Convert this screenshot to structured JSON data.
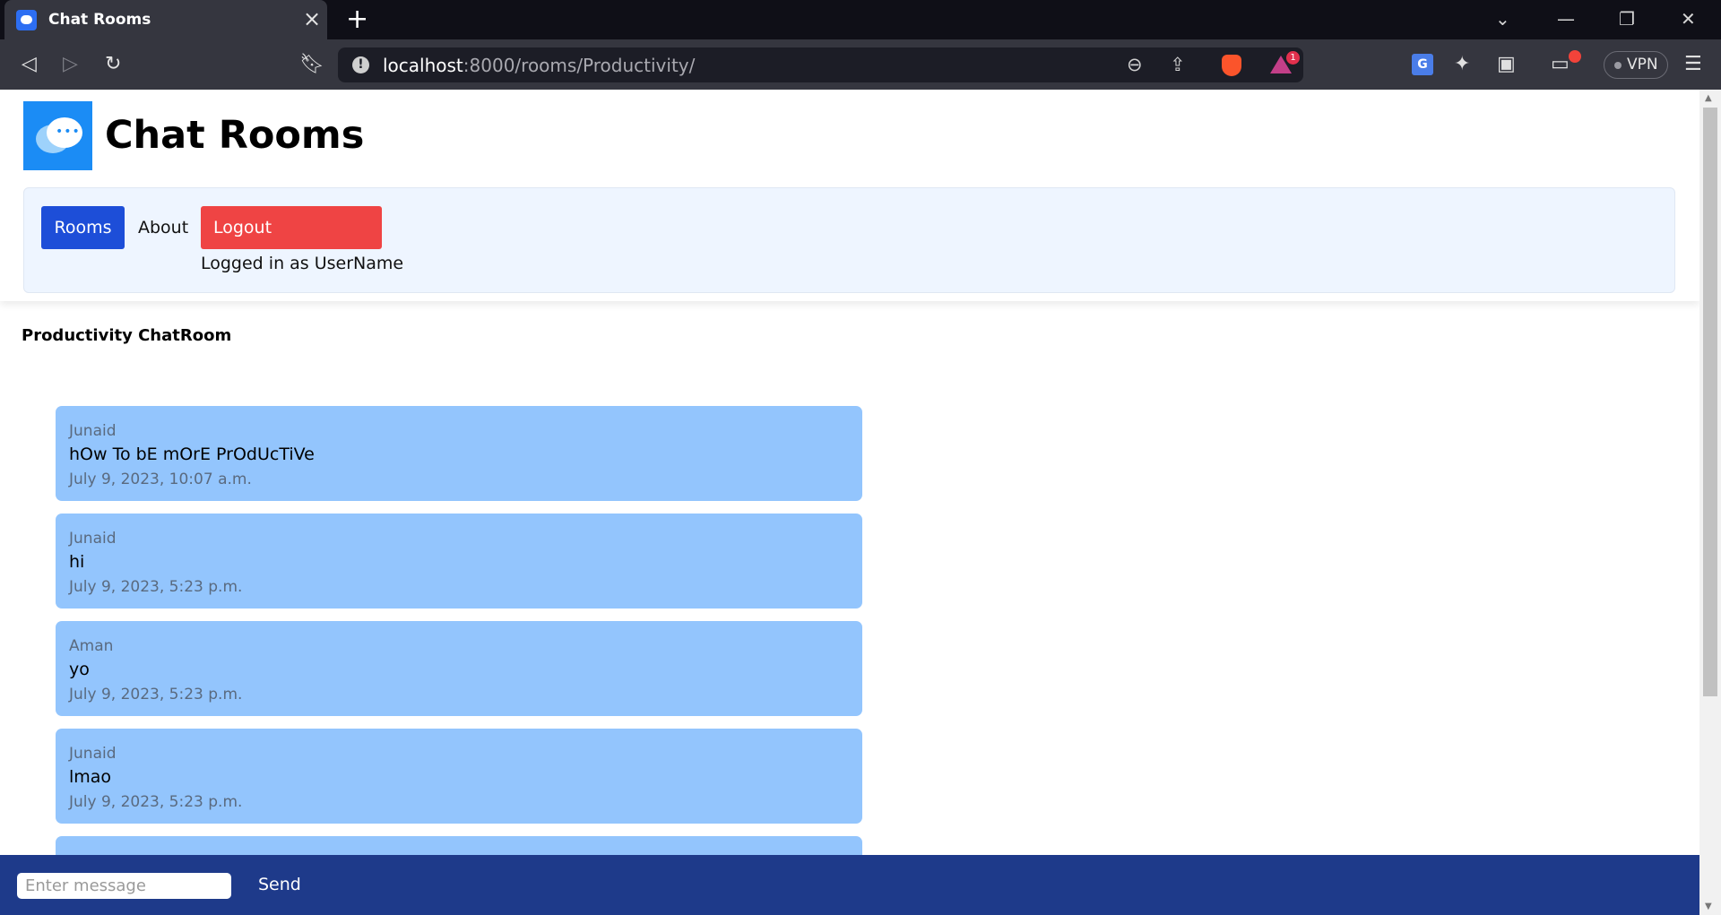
{
  "browser": {
    "tab_title": "Chat Rooms",
    "url_host": "localhost",
    "url_rest": ":8000/rooms/Productivity/",
    "rewards_badge": "1",
    "vpn_label": "VPN"
  },
  "header": {
    "title": "Chat Rooms"
  },
  "nav": {
    "rooms_label": "Rooms",
    "about_label": "About",
    "logout_label": "Logout",
    "logged_in_text": "Logged in as UserName"
  },
  "room": {
    "heading": "Productivity ChatRoom"
  },
  "messages": [
    {
      "user": "Junaid",
      "text": "hOw To bE mOrE PrOdUcTiVe",
      "time": "July 9, 2023, 10:07 a.m."
    },
    {
      "user": "Junaid",
      "text": "hi",
      "time": "July 9, 2023, 5:23 p.m."
    },
    {
      "user": "Aman",
      "text": "yo",
      "time": "July 9, 2023, 5:23 p.m."
    },
    {
      "user": "Junaid",
      "text": "lmao",
      "time": "July 9, 2023, 5:23 p.m."
    }
  ],
  "composer": {
    "placeholder": "Enter message",
    "send_label": "Send"
  },
  "colors": {
    "primary": "#1d4ed8",
    "danger": "#ef4444",
    "message_bg": "#93c5fd",
    "footer_bg": "#1e3a8a"
  }
}
